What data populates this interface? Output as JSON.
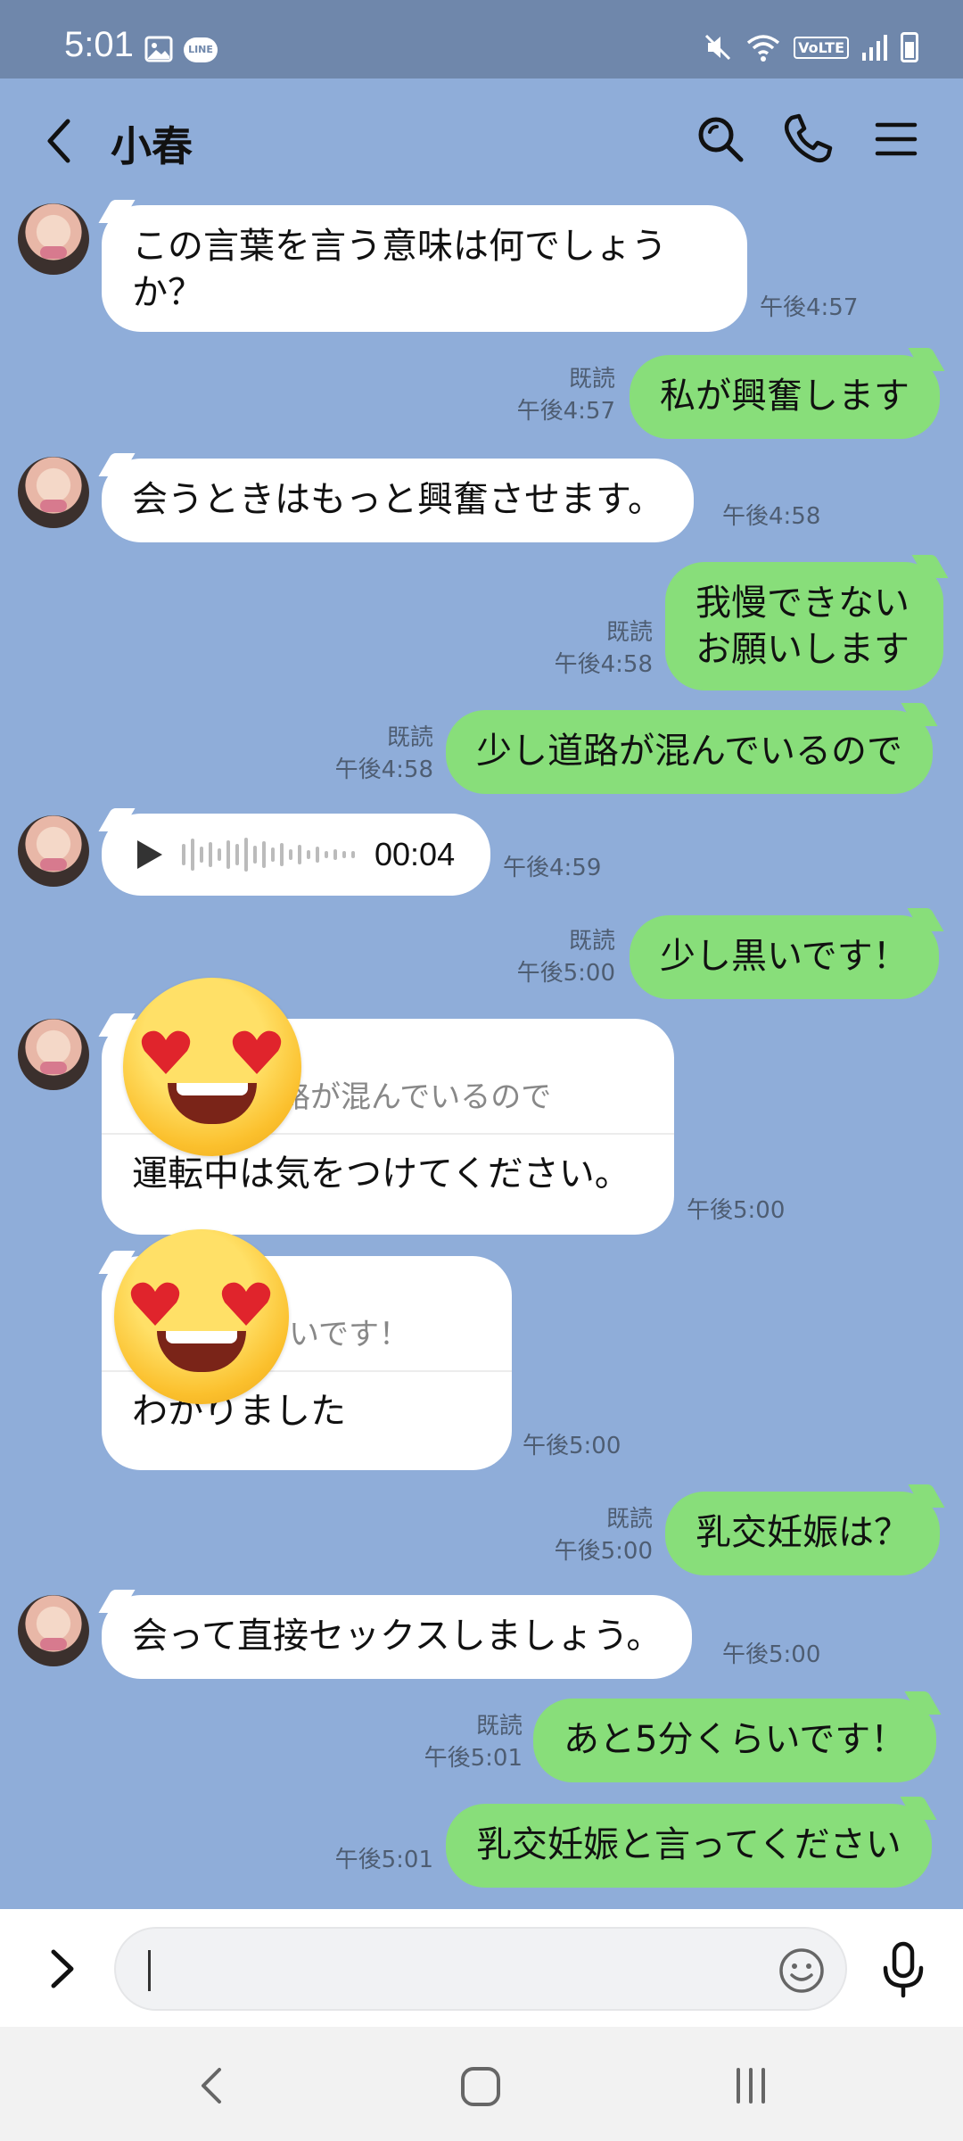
{
  "status_bar": {
    "time": "5:01",
    "volte": "VoLTE",
    "line_badge": "LINE"
  },
  "header": {
    "title": "小春"
  },
  "messages": [
    {
      "dir": "in",
      "text": "この言葉を言う意味は何でしょうか？",
      "lines": [
        "この言葉を言う意味は何でしょう",
        "か？"
      ],
      "time": "午後4:57"
    },
    {
      "dir": "out",
      "text": "私が興奮します",
      "read": "既読",
      "time": "午後4:57"
    },
    {
      "dir": "in",
      "text": "会うときはもっと興奮させます。",
      "time": "午後4:58"
    },
    {
      "dir": "out",
      "lines": [
        "我慢できない",
        "お願いします"
      ],
      "read": "既読",
      "time": "午後4:58"
    },
    {
      "dir": "out",
      "text": "少し道路が混んでいるので",
      "read": "既読",
      "time": "午後4:58"
    },
    {
      "dir": "in",
      "type": "voice",
      "duration": "00:04",
      "time": "午後4:59"
    },
    {
      "dir": "out",
      "text": "少し黒いです！",
      "read": "既読",
      "time": "午後5:00"
    },
    {
      "dir": "in",
      "type": "reply",
      "quote": "少し道路が混んでいるので",
      "quote_visible": "路が混んでいるので",
      "text": "運転中は気をつけてください。",
      "time": "午後5:00"
    },
    {
      "dir": "in",
      "type": "reply",
      "quote": "少し黒いです！",
      "quote_visible": "いです！",
      "text": "わかりました",
      "time": "午後5:00"
    },
    {
      "dir": "out",
      "text": "乳交妊娠は？",
      "read": "既読",
      "time": "午後5:00"
    },
    {
      "dir": "in",
      "text": "会って直接セックスしましょう。",
      "time": "午後5:00"
    },
    {
      "dir": "out",
      "text": "あと5分くらいです！",
      "read": "既読",
      "time": "午後5:01"
    },
    {
      "dir": "out",
      "text": "乳交妊娠と言ってください",
      "time": "午後5:01"
    }
  ],
  "input": {
    "placeholder": "",
    "value": ""
  },
  "colors": {
    "chat_background": "#8fadd9",
    "status_bar": "#6f87ab",
    "outgoing_bubble": "#88de7a",
    "incoming_bubble": "#ffffff"
  },
  "icons": [
    "back-arrow-icon",
    "search-icon",
    "phone-icon",
    "menu-icon",
    "play-icon",
    "smiling-face-with-heart-eyes-emoji",
    "expand-icon",
    "emoji-icon",
    "mic-icon"
  ]
}
